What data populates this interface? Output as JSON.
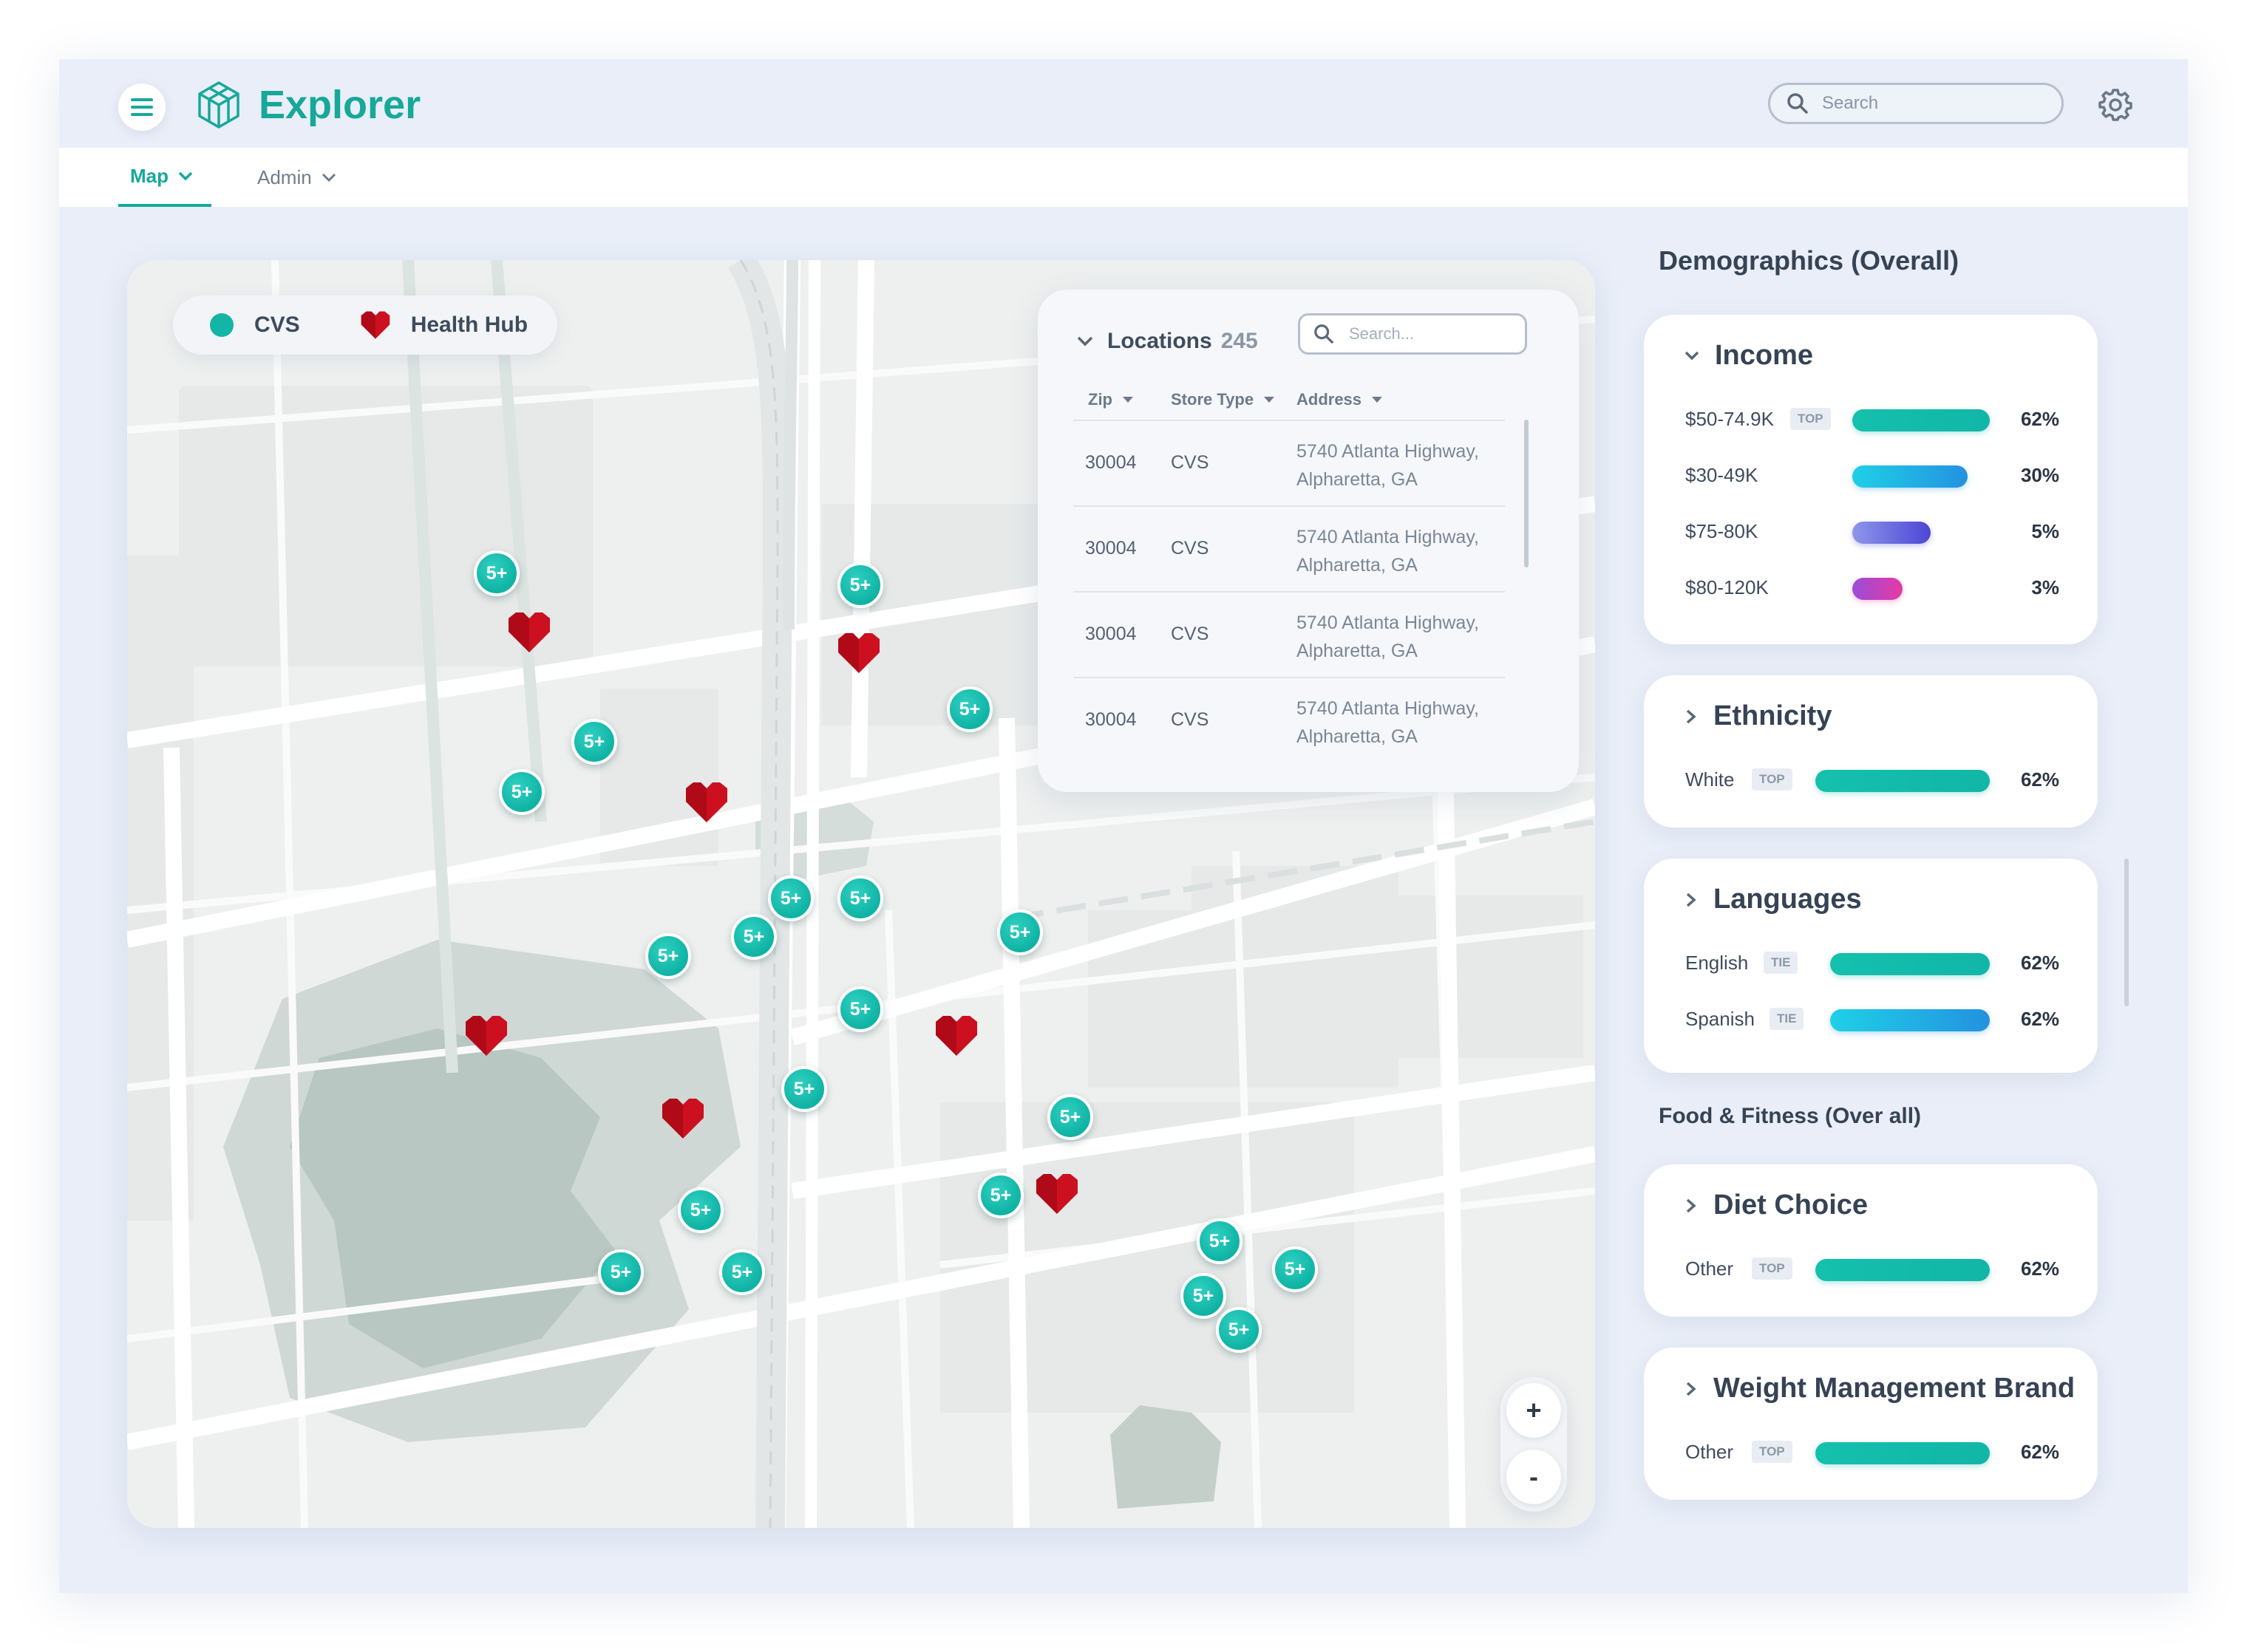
{
  "app": {
    "title": "Explorer"
  },
  "header": {
    "search_placeholder": "Search"
  },
  "nav": {
    "tabs": [
      {
        "label": "Map"
      },
      {
        "label": "Admin"
      }
    ]
  },
  "map": {
    "legend": [
      {
        "label": "CVS",
        "icon": "teal-dot-icon",
        "color": "#12b5a6"
      },
      {
        "label": "Health Hub",
        "icon": "heart-icon",
        "color": "#cc1020"
      }
    ],
    "cluster_label": "5+",
    "zoom_in": "+",
    "zoom_out": "-"
  },
  "locations": {
    "title": "Locations",
    "count": "245",
    "search_placeholder": "Search...",
    "columns": [
      "Zip",
      "Store Type",
      "Address"
    ],
    "rows": [
      {
        "zip": "30004",
        "type": "CVS",
        "address": "5740 Atlanta Highway, Alpharetta, GA"
      },
      {
        "zip": "30004",
        "type": "CVS",
        "address": "5740 Atlanta Highway, Alpharetta, GA"
      },
      {
        "zip": "30004",
        "type": "CVS",
        "address": "5740 Atlanta Highway, Alpharetta, GA"
      },
      {
        "zip": "30004",
        "type": "CVS",
        "address": "5740 Atlanta Highway, Alpharetta, GA"
      }
    ]
  },
  "panel": {
    "title": "Demographics (Overall)",
    "food_title": "Food & Fitness (Over all)",
    "income": {
      "title": "Income",
      "rows": [
        {
          "label": "$50-74.9K",
          "tag": "TOP",
          "pct": "62%"
        },
        {
          "label": "$30-49K",
          "tag": "",
          "pct": "30%"
        },
        {
          "label": "$75-80K",
          "tag": "",
          "pct": "5%"
        },
        {
          "label": "$80-120K",
          "tag": "",
          "pct": "3%"
        }
      ]
    },
    "ethnicity": {
      "title": "Ethnicity",
      "rows": [
        {
          "label": "White",
          "tag": "TOP",
          "pct": "62%"
        }
      ]
    },
    "languages": {
      "title": "Languages",
      "rows": [
        {
          "label": "English",
          "tag": "TIE",
          "pct": "62%"
        },
        {
          "label": "Spanish",
          "tag": "TIE",
          "pct": "62%"
        }
      ]
    },
    "diet": {
      "title": "Diet Choice",
      "rows": [
        {
          "label": "Other",
          "tag": "TOP",
          "pct": "62%"
        }
      ]
    },
    "weight": {
      "title": "Weight Management Brand",
      "rows": [
        {
          "label": "Other",
          "tag": "TOP",
          "pct": "62%"
        }
      ]
    }
  }
}
